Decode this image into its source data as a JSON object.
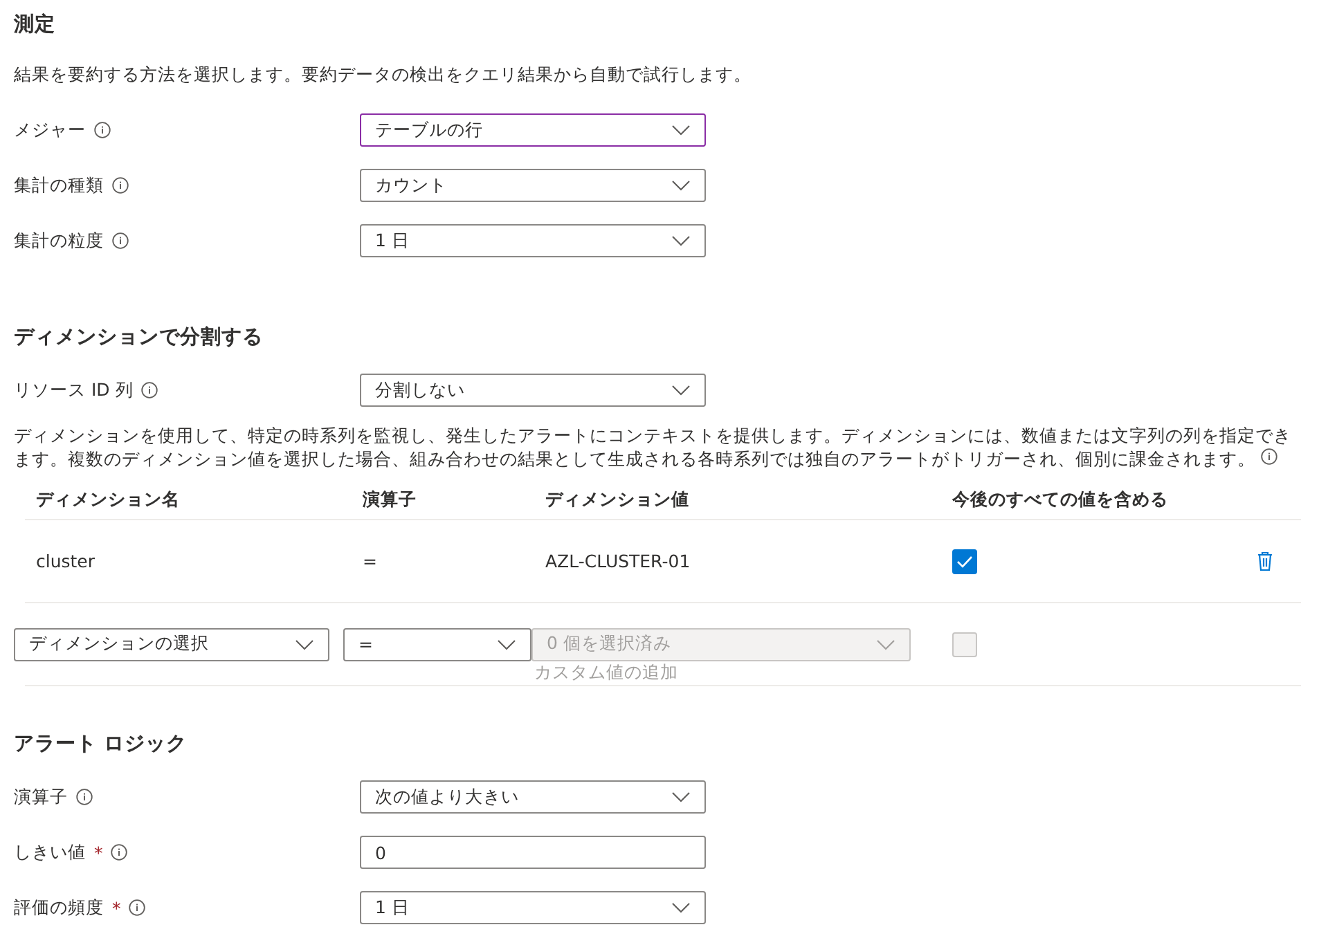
{
  "measurement": {
    "title": "測定",
    "description": "結果を要約する方法を選択します。要約データの検出をクエリ結果から自動で試行します。",
    "fields": [
      {
        "label": "メジャー",
        "kind": "select",
        "value": "テーブルの行",
        "focused": true
      },
      {
        "label": "集計の種類",
        "kind": "select",
        "value": "カウント",
        "focused": false
      },
      {
        "label": "集計の粒度",
        "kind": "select",
        "value": "1 日",
        "focused": false
      }
    ]
  },
  "split": {
    "title": "ディメンションで分割する",
    "fields": [
      {
        "label": "リソース ID 列",
        "kind": "select",
        "value": "分割しない",
        "focused": false
      }
    ],
    "description": "ディメンションを使用して、特定の時系列を監視し、発生したアラートにコンテキストを提供します。ディメンションには、数値または文字列の列を指定できます。複数のディメンション値を選択した場合、組み合わせの結果として生成される各時系列では独自のアラートがトリガーされ、個別に課金されます。",
    "table": {
      "columns": [
        "ディメンション名",
        "演算子",
        "ディメンション値",
        "今後のすべての値を含める"
      ],
      "rows": [
        {
          "name": "cluster",
          "operator": "=",
          "value": "AZL-CLUSTER-01",
          "include_future": true
        }
      ],
      "new_row": {
        "dimension": "ディメンションの選択",
        "operator": "=",
        "values": "0 個を選択済み",
        "values_disabled": true,
        "custom_hint": "カスタム値の追加",
        "include_future": false
      }
    }
  },
  "logic": {
    "title": "アラート ロジック",
    "fields": [
      {
        "label": "演算子",
        "kind": "select",
        "value": "次の値より大きい",
        "focused": false
      },
      {
        "label": "しきい値",
        "kind": "text",
        "value": "0",
        "focused": false,
        "required_mark": "*"
      },
      {
        "label": "評価の頻度",
        "kind": "select",
        "value": "1 日",
        "focused": false,
        "required_mark": "*"
      }
    ]
  }
}
